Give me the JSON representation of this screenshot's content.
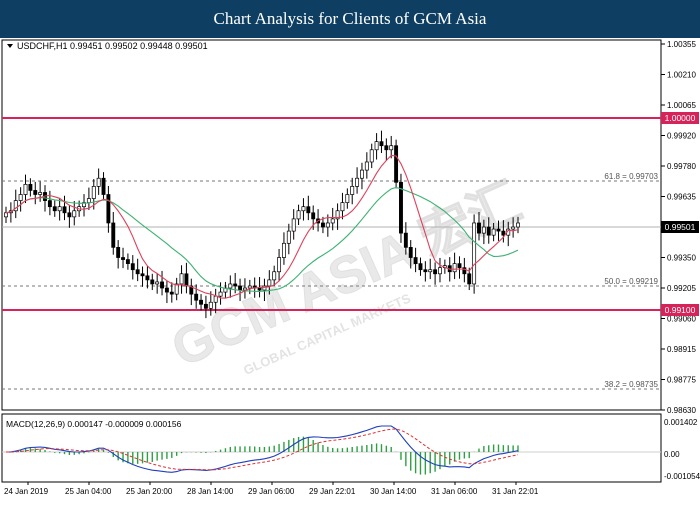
{
  "header": {
    "title": "Chart Analysis for Clients of GCM Asia"
  },
  "symbol_info": "USDCHF,H1  0.99451 0.99502 0.99448 0.99501",
  "price_ticks": [
    "1.00355",
    "1.00210",
    "1.00065",
    "0.99920",
    "0.99780",
    "0.99635",
    "0.99490",
    "0.99350",
    "0.99205",
    "0.99060",
    "0.98915",
    "0.98775",
    "0.98630"
  ],
  "levels": {
    "resistance": "1.00000",
    "support": "0.99100",
    "current": "0.99501"
  },
  "fib_labels": {
    "fib618": "61.8 = 0.99703",
    "fib50": "50.0 = 0.99219",
    "fib382": "38.2 = 0.98735"
  },
  "macd": {
    "label": "MACD(12,26,9) 0.000147 -0.000009 0.000156",
    "ticks": [
      "0.001402",
      "0.00",
      "-0.001054"
    ]
  },
  "time_ticks": [
    "24 Jan 2019",
    "25 Jan 04:00",
    "25 Jan 20:00",
    "28 Jan 14:00",
    "29 Jan 06:00",
    "29 Jan 22:01",
    "30 Jan 14:00",
    "31 Jan 06:00",
    "31 Jan 22:01"
  ],
  "watermark": {
    "brand": "GCM ASIA 宏汇",
    "tagline": "GLOBAL CAPITAL MARKETS"
  },
  "colors": {
    "header_bg": "#0e3f63",
    "bull": "#2ea043",
    "bear": "#c8102e",
    "level_line": "#d6245a",
    "ma_fast": "#e0405a",
    "ma_slow": "#3cb371",
    "macd_line": "#1f3fbf",
    "signal_line": "#e03030"
  },
  "chart_data": {
    "type": "candlestick",
    "series": [
      {
        "name": "USDCHF,H1",
        "values": [
          0.9955,
          0.9956,
          0.9961,
          0.9964,
          0.9969,
          0.9966,
          0.9964,
          0.9965,
          0.9961,
          0.9958,
          0.9956,
          0.9958,
          0.9955,
          0.9953,
          0.9956,
          0.9958,
          0.996,
          0.9962,
          0.9968,
          0.9972,
          0.9964,
          0.995,
          0.9938,
          0.9933,
          0.9932,
          0.993,
          0.9927,
          0.9925,
          0.9924,
          0.9922,
          0.992,
          0.9921,
          0.9918,
          0.9916,
          0.9915,
          0.992,
          0.9925,
          0.9919,
          0.9915,
          0.9912,
          0.991,
          0.9908,
          0.9911,
          0.9914,
          0.9916,
          0.9918,
          0.992,
          0.9919,
          0.9917,
          0.9918,
          0.9919,
          0.9918,
          0.9917,
          0.9919,
          0.9922,
          0.9926,
          0.9933,
          0.994,
          0.9946,
          0.9952,
          0.9956,
          0.9958,
          0.9955,
          0.9952,
          0.995,
          0.9948,
          0.995,
          0.9952,
          0.9956,
          0.996,
          0.9964,
          0.9968,
          0.9972,
          0.9976,
          0.998,
          0.9986,
          0.999,
          0.9988,
          0.9986,
          0.9988,
          0.997,
          0.9945,
          0.9938,
          0.9933,
          0.993,
          0.9927,
          0.9926,
          0.9927,
          0.9925,
          0.9928,
          0.9929,
          0.9926,
          0.993,
          0.9928,
          0.9925,
          0.992,
          0.995,
          0.9945,
          0.9948,
          0.9944,
          0.9947,
          0.9946,
          0.9944,
          0.9947,
          0.9948,
          0.995
        ]
      }
    ],
    "xlabel": "",
    "ylabel": "",
    "ylim": [
      0.9858,
      1.004
    ]
  }
}
